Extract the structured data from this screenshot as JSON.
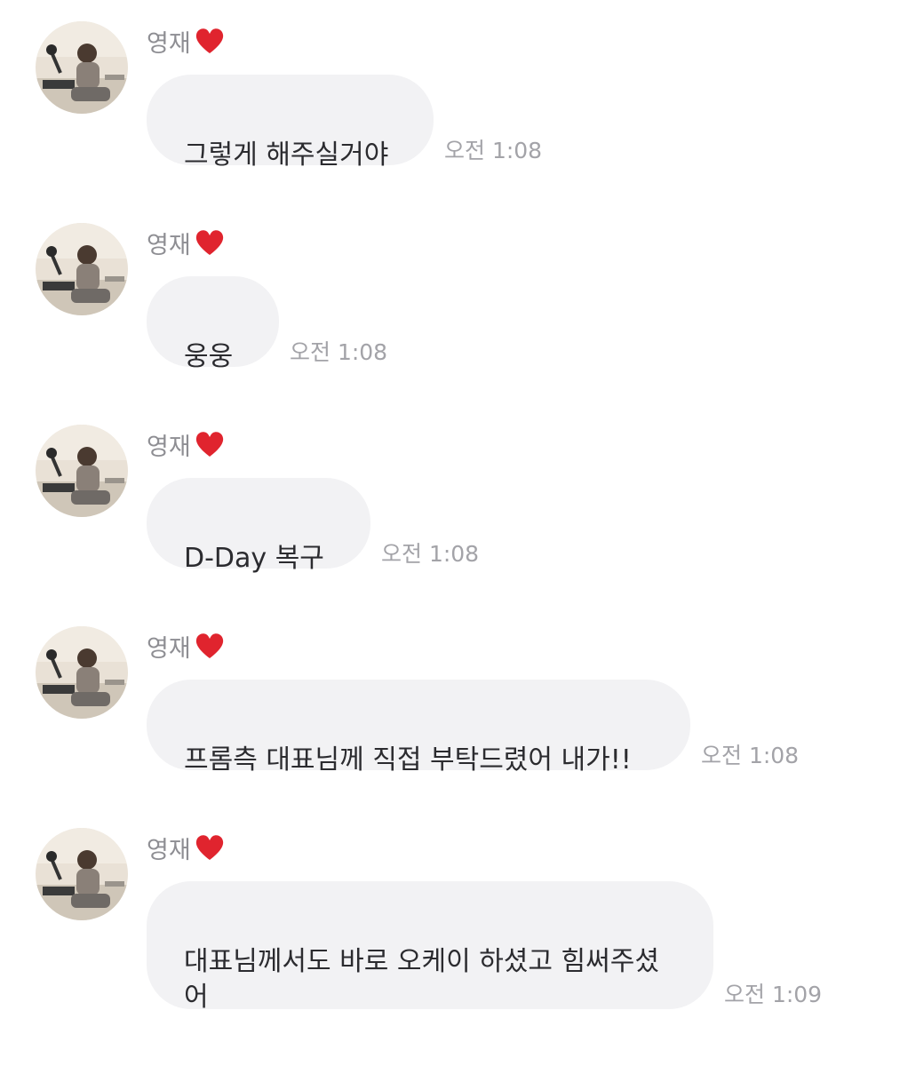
{
  "chat": {
    "messages": [
      {
        "sender": "영재",
        "text": "그렇게 해주실거야",
        "time": "오전 1:08"
      },
      {
        "sender": "영재",
        "text": "웅웅",
        "time": "오전 1:08"
      },
      {
        "sender": "영재",
        "text": "D-Day 복구",
        "time": "오전 1:08"
      },
      {
        "sender": "영재",
        "text": "프롬측 대표님께 직접 부탁드렸어 내가!!",
        "time": "오전 1:08"
      },
      {
        "sender": "영재",
        "text": "대표님께서도 바로 오케이 하셨고 힘써주셨\n어",
        "time": "오전 1:09"
      }
    ]
  },
  "colors": {
    "bubble_bg": "#f2f2f4",
    "sender_text": "#8e8e93",
    "time_text": "#a3a3a8",
    "heart": "#e0242e"
  },
  "icons": {
    "sender_badge": "red-heart-icon",
    "avatar": "profile-photo"
  }
}
